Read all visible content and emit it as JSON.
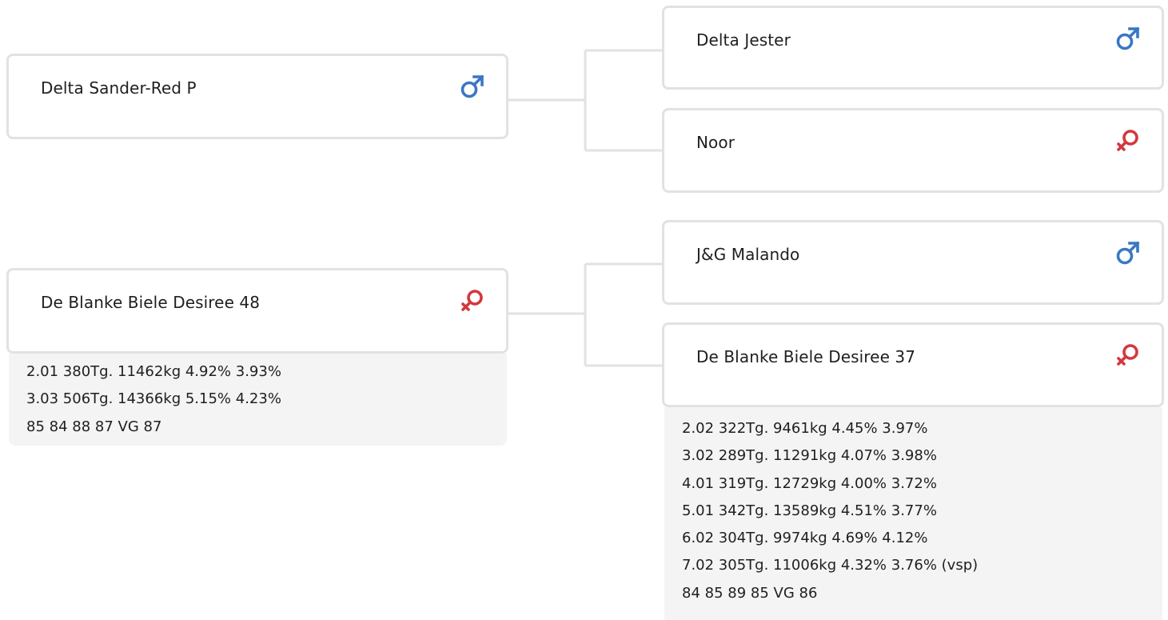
{
  "tree": {
    "parents": [
      {
        "name": "Delta Sander-Red P",
        "sex": "male",
        "sex_icon": "male-icon",
        "stats": []
      },
      {
        "name": "De Blanke Biele Desiree 48",
        "sex": "female",
        "sex_icon": "female-icon",
        "stats": [
          "2.01 380Tg. 11462kg 4.92% 3.93%",
          "3.03 506Tg. 14366kg 5.15% 4.23%",
          "85 84 88 87 VG 87"
        ]
      }
    ],
    "grandparents": [
      {
        "name": "Delta Jester",
        "sex": "male",
        "sex_icon": "male-icon",
        "stats": []
      },
      {
        "name": "Noor",
        "sex": "female",
        "sex_icon": "female-icon",
        "stats": []
      },
      {
        "name": "J&G Malando",
        "sex": "male",
        "sex_icon": "male-icon",
        "stats": []
      },
      {
        "name": "De Blanke Biele Desiree 37",
        "sex": "female",
        "sex_icon": "female-icon",
        "stats": [
          "2.02 322Tg. 9461kg 4.45% 3.97%",
          "3.02 289Tg. 11291kg 4.07% 3.98%",
          "4.01 319Tg. 12729kg 4.00% 3.72%",
          "5.01 342Tg. 13589kg 4.51% 3.77%",
          "6.02 304Tg. 9974kg 4.69% 4.12%",
          "7.02 305Tg. 11006kg 4.32% 3.76% (vsp)",
          "84 85 89 85 VG 86"
        ]
      }
    ]
  },
  "colors": {
    "male": "#3a77c3",
    "female": "#d2383d",
    "border": "#e2e2e2",
    "connector": "#e2e2e2",
    "stats_bg": "#f4f4f4"
  }
}
